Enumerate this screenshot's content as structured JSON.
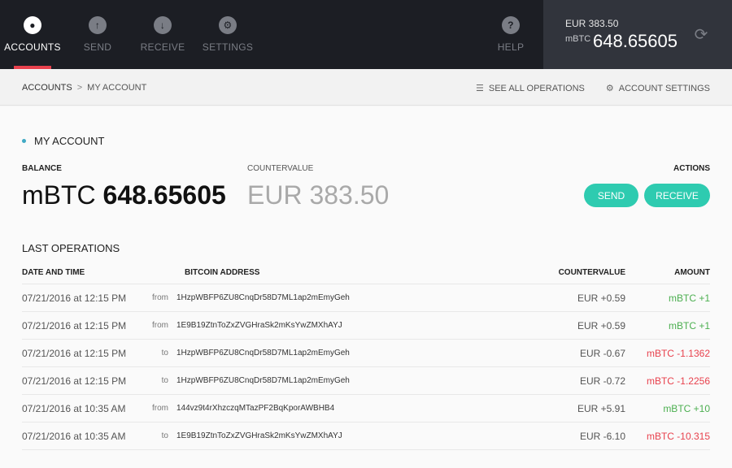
{
  "nav": {
    "items": [
      {
        "label": "ACCOUNTS",
        "icon": "accounts-icon",
        "glyph": "●",
        "active": true
      },
      {
        "label": "SEND",
        "icon": "send-arrow-up-icon",
        "glyph": "↑",
        "active": false
      },
      {
        "label": "RECEIVE",
        "icon": "receive-arrow-down-icon",
        "glyph": "↓",
        "active": false
      },
      {
        "label": "SETTINGS",
        "icon": "gear-icon",
        "glyph": "⚙",
        "active": false
      }
    ],
    "help": {
      "label": "HELP",
      "icon": "help-icon",
      "glyph": "?"
    }
  },
  "header_balance": {
    "eur": "EUR 383.50",
    "unit": "mBTC",
    "value": "648.65605",
    "refresh_icon": "refresh-icon"
  },
  "breadcrumb": {
    "root": "ACCOUNTS",
    "separator": ">",
    "current": "MY ACCOUNT"
  },
  "toolbar": {
    "see_all": "SEE ALL OPERATIONS",
    "account_settings": "ACCOUNT SETTINGS"
  },
  "account": {
    "title": "MY ACCOUNT",
    "balance_label": "BALANCE",
    "balance_unit": "mBTC",
    "balance_value": "648.65605",
    "countervalue_label": "COUNTERVALUE",
    "countervalue": "EUR 383.50",
    "actions_label": "ACTIONS",
    "send_label": "SEND",
    "receive_label": "RECEIVE"
  },
  "operations": {
    "title": "LAST OPERATIONS",
    "columns": {
      "date": "DATE AND TIME",
      "address": "BITCOIN ADDRESS",
      "countervalue": "COUNTERVALUE",
      "amount": "AMOUNT"
    },
    "rows": [
      {
        "date": "07/21/2016 at 12:15 PM",
        "dir": "from",
        "address": "1HzpWBFP6ZU8CnqDr58D7ML1ap2mEmyGeh",
        "countervalue": "EUR +0.59",
        "amount": "mBTC +1",
        "sign": "pos"
      },
      {
        "date": "07/21/2016 at 12:15 PM",
        "dir": "from",
        "address": "1E9B19ZtnToZxZVGHraSk2mKsYwZMXhAYJ",
        "countervalue": "EUR +0.59",
        "amount": "mBTC +1",
        "sign": "pos"
      },
      {
        "date": "07/21/2016 at 12:15 PM",
        "dir": "to",
        "address": "1HzpWBFP6ZU8CnqDr58D7ML1ap2mEmyGeh",
        "countervalue": "EUR -0.67",
        "amount": "mBTC -1.1362",
        "sign": "neg"
      },
      {
        "date": "07/21/2016 at 12:15 PM",
        "dir": "to",
        "address": "1HzpWBFP6ZU8CnqDr58D7ML1ap2mEmyGeh",
        "countervalue": "EUR -0.72",
        "amount": "mBTC -1.2256",
        "sign": "neg"
      },
      {
        "date": "07/21/2016 at 10:35 AM",
        "dir": "from",
        "address": "144vz9t4rXhzczqMTazPF2BqKporAWBHB4",
        "countervalue": "EUR +5.91",
        "amount": "mBTC +10",
        "sign": "pos"
      },
      {
        "date": "07/21/2016 at 10:35 AM",
        "dir": "to",
        "address": "1E9B19ZtnToZxZVGHraSk2mKsYwZMXhAYJ",
        "countervalue": "EUR -6.10",
        "amount": "mBTC -10.315",
        "sign": "neg"
      }
    ]
  },
  "colors": {
    "accent": "#2ecbb0",
    "active_tab": "#e8414d",
    "positive": "#4caf50",
    "negative": "#e8414d"
  }
}
